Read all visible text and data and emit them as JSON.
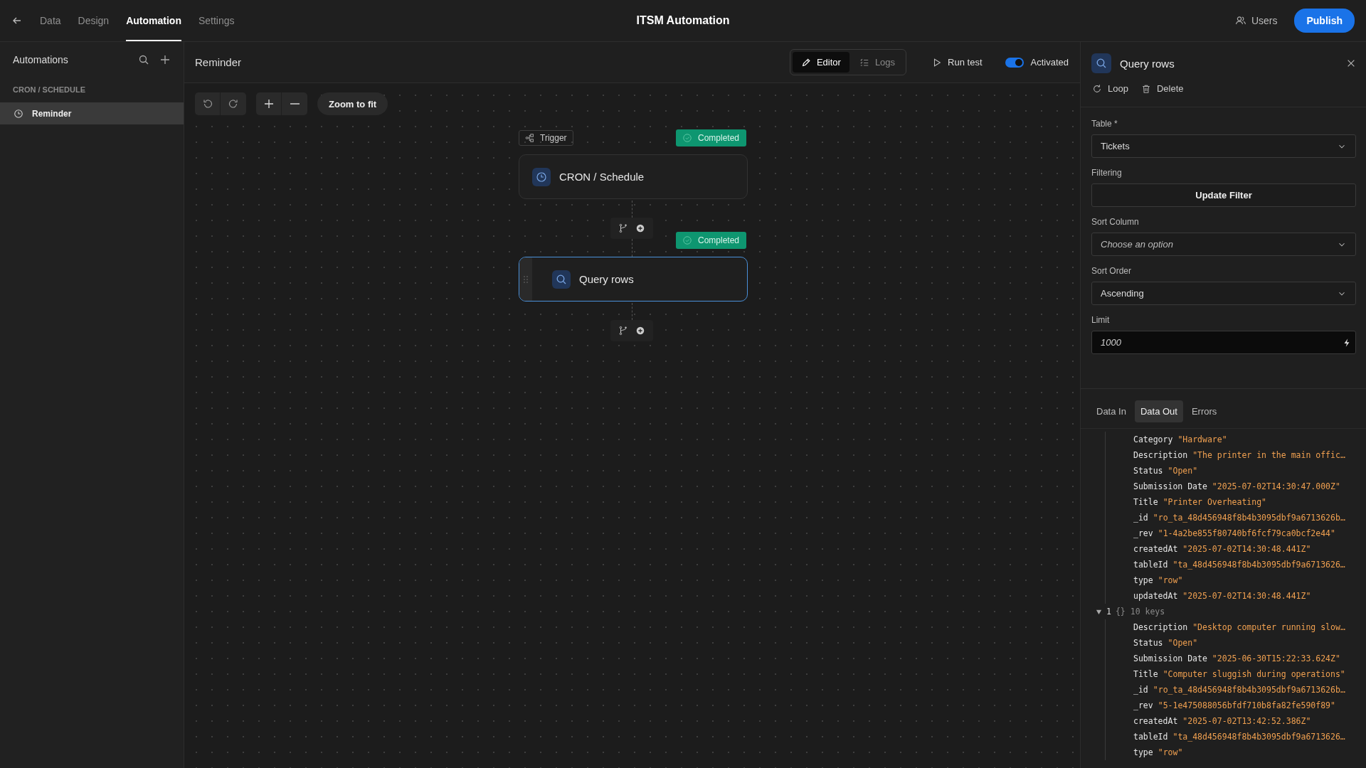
{
  "nav": {
    "items": [
      {
        "label": "Data",
        "selected": false
      },
      {
        "label": "Design",
        "selected": false
      },
      {
        "label": "Automation",
        "selected": true
      },
      {
        "label": "Settings",
        "selected": false
      }
    ],
    "title": "ITSM Automation",
    "users": "Users",
    "publish": "Publish"
  },
  "sidebar": {
    "title": "Automations",
    "group": "CRON / SCHEDULE",
    "items": [
      {
        "label": "Reminder",
        "selected": true
      }
    ]
  },
  "editor": {
    "title": "Reminder",
    "modes": [
      {
        "label": "Editor",
        "selected": true
      },
      {
        "label": "Logs",
        "selected": false
      }
    ],
    "run_test": "Run test",
    "activated": {
      "label": "Activated",
      "on": true
    }
  },
  "canvas": {
    "zoom_to_fit": "Zoom to fit",
    "steps": [
      {
        "kind": "trigger",
        "tag": "Trigger",
        "status": "Completed",
        "name": "CRON / Schedule",
        "selected": false
      },
      {
        "kind": "action",
        "status": "Completed",
        "name": "Query rows",
        "selected": true
      }
    ]
  },
  "panel": {
    "title": "Query rows",
    "actions": [
      {
        "label": "Loop"
      },
      {
        "label": "Delete"
      }
    ],
    "fields": [
      {
        "label": "Table *",
        "kind": "select",
        "value": "Tickets"
      },
      {
        "label": "Filtering",
        "kind": "button",
        "value": "Update Filter"
      },
      {
        "label": "Sort Column",
        "kind": "select",
        "placeholder": "Choose an option"
      },
      {
        "label": "Sort Order",
        "kind": "select",
        "value": "Ascending"
      },
      {
        "label": "Limit",
        "kind": "input",
        "value": "1000"
      }
    ],
    "tabs": [
      {
        "label": "Data In",
        "selected": false
      },
      {
        "label": "Data Out",
        "selected": true
      },
      {
        "label": "Errors",
        "selected": false
      }
    ],
    "rows": [
      {
        "fields": [
          {
            "key": "Category",
            "value": "\"Hardware\""
          },
          {
            "key": "Description",
            "value": "\"The printer in the main offic…"
          },
          {
            "key": "Status",
            "value": "\"Open\""
          },
          {
            "key": "Submission Date",
            "value": "\"2025-07-02T14:30:47.000Z\""
          },
          {
            "key": "Title",
            "value": "\"Printer Overheating\""
          },
          {
            "key": "_id",
            "value": "\"ro_ta_48d456948f8b4b3095dbf9a6713626b…"
          },
          {
            "key": "_rev",
            "value": "\"1-4a2be855f80740bf6fcf79ca0bcf2e44\""
          },
          {
            "key": "createdAt",
            "value": "\"2025-07-02T14:30:48.441Z\""
          },
          {
            "key": "tableId",
            "value": "\"ta_48d456948f8b4b3095dbf9a6713626…"
          },
          {
            "key": "type",
            "value": "\"row\""
          },
          {
            "key": "updatedAt",
            "value": "\"2025-07-02T14:30:48.441Z\""
          }
        ]
      },
      {
        "index": "1",
        "summary": "{} 10 keys",
        "expanded": true,
        "fields": [
          {
            "key": "Description",
            "value": "\"Desktop computer running slow…"
          },
          {
            "key": "Status",
            "value": "\"Open\""
          },
          {
            "key": "Submission Date",
            "value": "\"2025-06-30T15:22:33.624Z\""
          },
          {
            "key": "Title",
            "value": "\"Computer sluggish during operations\""
          },
          {
            "key": "_id",
            "value": "\"ro_ta_48d456948f8b4b3095dbf9a6713626b…"
          },
          {
            "key": "_rev",
            "value": "\"5-1e475088056bfdf710b8fa82fe590f89\""
          },
          {
            "key": "createdAt",
            "value": "\"2025-07-02T13:42:52.386Z\""
          },
          {
            "key": "tableId",
            "value": "\"ta_48d456948f8b4b3095dbf9a6713626…"
          },
          {
            "key": "type",
            "value": "\"row\""
          }
        ]
      }
    ]
  }
}
